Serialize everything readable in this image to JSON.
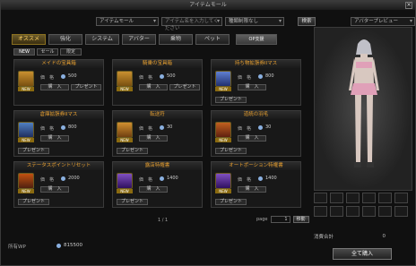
{
  "window": {
    "title": "アイテムモール",
    "close": "×"
  },
  "filters": {
    "category": "アイテムモール",
    "search_placeholder": "アイテム名を入力してください",
    "restriction": "種類制限なし",
    "search_button": "検索",
    "avatar_preview": "アバタープレビュー"
  },
  "tabs": [
    "オススメ",
    "強化",
    "システム",
    "アバター",
    "乗物",
    "ペット",
    "OP支援"
  ],
  "subtabs": [
    "NEW",
    "セール",
    "限定"
  ],
  "labels": {
    "price": "価　格",
    "buy": "購　入",
    "gift": "プレゼント",
    "new_badge": "NEW"
  },
  "items": [
    {
      "name": "メイドの宝具箱",
      "price": "500"
    },
    {
      "name": "騎乗の宝具箱",
      "price": "500"
    },
    {
      "name": "持ち物拡張券IIマス",
      "price": "800"
    },
    {
      "name": "倉庫拡張券IIマス",
      "price": "800"
    },
    {
      "name": "転送符",
      "price": "30"
    },
    {
      "name": "道統の羽毛",
      "price": "30"
    },
    {
      "name": "ステータスポイントリセット",
      "price": "2000"
    },
    {
      "name": "露店特権書",
      "price": "1400"
    },
    {
      "name": "オートポーション特権書",
      "price": "1400"
    }
  ],
  "pager": {
    "text": "1 / 1",
    "page_label": "page",
    "page_value": "1",
    "go": "移動"
  },
  "wallet": {
    "label": "所有WP",
    "value": "815500"
  },
  "cart": {
    "label": "消費合計",
    "value": "0",
    "buy_all": "全て購入"
  },
  "colors": {
    "accent": "#e8a030",
    "active_tab": "#ffd060",
    "coin": "#8ab0e0"
  }
}
